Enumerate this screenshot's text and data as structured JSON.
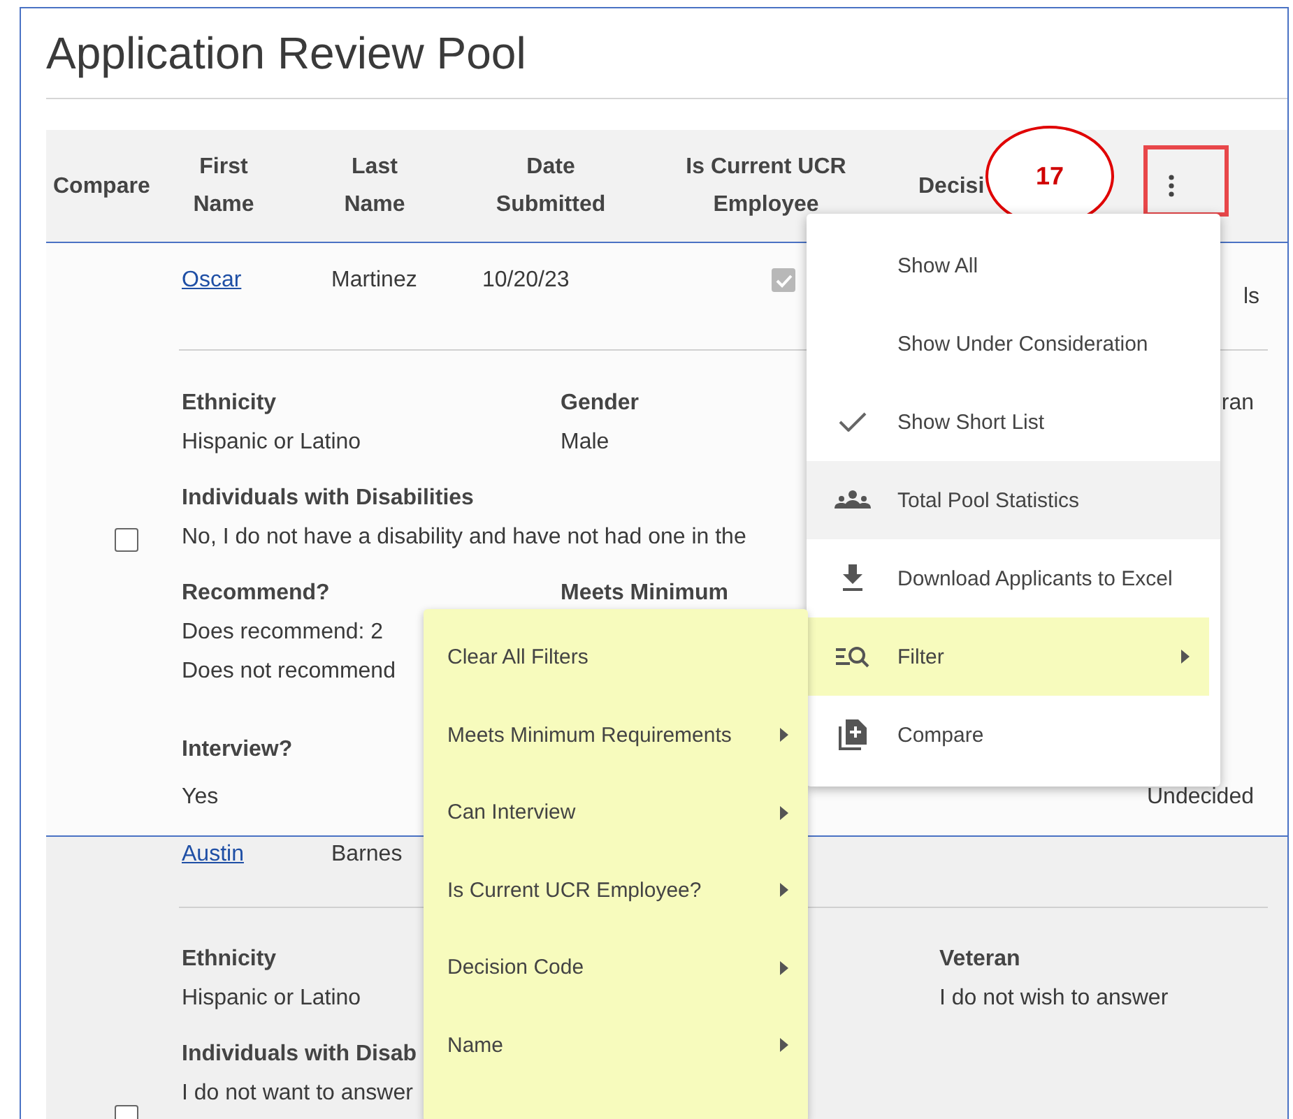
{
  "title": "Application Review Pool",
  "columns": [
    "Compare",
    "First Name",
    "Last Name",
    "Date Submitted",
    "Is Current UCR Employee",
    "Decisi"
  ],
  "callout": "17",
  "rows": [
    {
      "first_name": "Oscar",
      "last_name": "Martinez",
      "date": "10/20/23",
      "current_employee": true,
      "column_6": "ls",
      "compare_checked": false,
      "sections": [
        {
          "col_1": {
            "label": "Ethnicity",
            "lines": [
              "Hispanic or Latino"
            ]
          },
          "col_2": {
            "label": "Gender",
            "lines": [
              "Male"
            ]
          },
          "col_3": {
            "lines": [
              "ran"
            ]
          }
        },
        {
          "col_1": {
            "label": "Individuals with Disabilities",
            "lines": [
              "No, I do not have a disability and have not had one in the"
            ]
          }
        },
        {
          "col_1": {
            "label": "Recommend?",
            "lines": [
              "Does recommend: 2",
              "Does not recommend"
            ]
          },
          "col_2": {
            "label": "Meets Minimum"
          }
        },
        {
          "col_1": {
            "label": "Interview?",
            "lines": [
              "Yes"
            ]
          },
          "col_3": {
            "lines": [
              "Undecided"
            ]
          }
        }
      ]
    },
    {
      "first_name": "Austin",
      "last_name": "Barnes",
      "compare_checked": false,
      "sections": [
        {
          "col_1": {
            "label": "Ethnicity",
            "lines": [
              "Hispanic or Latino"
            ]
          },
          "col_3": {
            "label": "Veteran",
            "lines": [
              "I do not wish to answer"
            ]
          }
        },
        {
          "col_1": {
            "label": "Individuals with Disab",
            "lines": [
              "I do not want to answer"
            ]
          }
        }
      ]
    }
  ],
  "menu": {
    "items": [
      {
        "label": "Show All",
        "checked": false,
        "hovered": false,
        "open": false,
        "submenu": false
      },
      {
        "label": "Show Under Consideration",
        "checked": false,
        "hovered": false,
        "open": false,
        "submenu": false
      },
      {
        "label": "Show Short List",
        "checked": true,
        "hovered": false,
        "open": false,
        "submenu": false
      },
      {
        "label": "Total Pool Statistics",
        "checked": false,
        "hovered": true,
        "open": false,
        "submenu": false
      },
      {
        "label": "Download Applicants to Excel",
        "checked": false,
        "hovered": false,
        "open": false,
        "submenu": false
      },
      {
        "label": "Filter",
        "checked": false,
        "hovered": false,
        "open": true,
        "submenu": true
      },
      {
        "label": "Compare",
        "checked": false,
        "hovered": false,
        "open": false,
        "submenu": false
      }
    ]
  },
  "filter_submenu": {
    "items": [
      {
        "label": "Clear All Filters",
        "submenu": false
      },
      {
        "label": "Meets Minimum Requirements",
        "submenu": true
      },
      {
        "label": "Can Interview",
        "submenu": true
      },
      {
        "label": "Is Current UCR Employee?",
        "submenu": true
      },
      {
        "label": "Decision Code",
        "submenu": true
      },
      {
        "label": "Name",
        "submenu": true
      }
    ]
  }
}
